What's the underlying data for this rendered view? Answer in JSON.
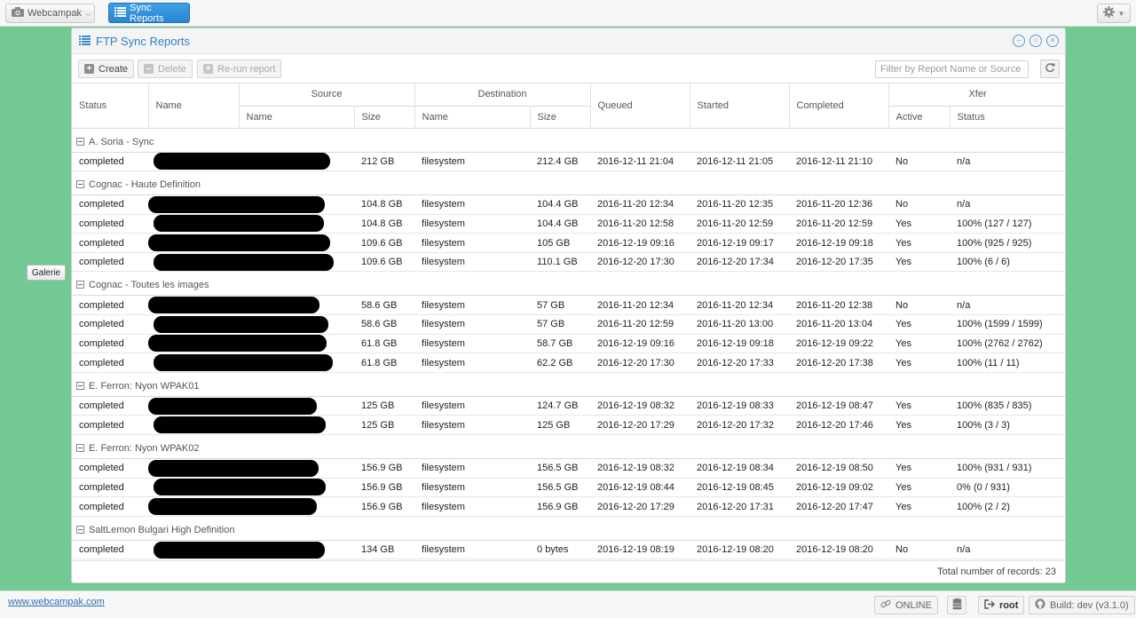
{
  "topbar": {
    "app_label": "Webcampak",
    "active_button": "Sync Reports"
  },
  "desktop": {
    "galerie_label": "Galerie"
  },
  "window": {
    "title": "FTP Sync Reports",
    "toolbar": {
      "create": "Create",
      "delete": "Delete",
      "rerun": "Re-run report"
    },
    "filter_placeholder": "Filter by Report Name or Source",
    "columns": {
      "status": "Status",
      "name": "Name",
      "source": "Source",
      "destination": "Destination",
      "queued": "Queued",
      "started": "Started",
      "completed": "Completed",
      "xfer": "Xfer",
      "sub_name": "Name",
      "sub_size": "Size",
      "sub_active": "Active",
      "sub_status": "Status"
    },
    "groups": [
      {
        "title": "A. Soria - Sync",
        "rows": [
          {
            "status": "completed",
            "src_size": "212 GB",
            "dest": "filesystem",
            "dest_size": "212.4 GB",
            "queued": "2016-12-11 21:04",
            "started": "2016-12-11 21:05",
            "completed": "2016-12-11 21:10",
            "active": "No",
            "xfer": "n/a"
          }
        ]
      },
      {
        "title": "Cognac - Haute Definition",
        "rows": [
          {
            "status": "completed",
            "src_size": "104.8 GB",
            "dest": "filesystem",
            "dest_size": "104.4 GB",
            "queued": "2016-11-20 12:34",
            "started": "2016-11-20 12:35",
            "completed": "2016-11-20 12:36",
            "active": "No",
            "xfer": "n/a"
          },
          {
            "status": "completed",
            "src_size": "104.8 GB",
            "dest": "filesystem",
            "dest_size": "104.4 GB",
            "queued": "2016-11-20 12:58",
            "started": "2016-11-20 12:59",
            "completed": "2016-11-20 12:59",
            "active": "Yes",
            "xfer": "100% (127 / 127)"
          },
          {
            "status": "completed",
            "src_size": "109.6 GB",
            "dest": "filesystem",
            "dest_size": "105 GB",
            "queued": "2016-12-19 09:16",
            "started": "2016-12-19 09:17",
            "completed": "2016-12-19 09:18",
            "active": "Yes",
            "xfer": "100% (925 / 925)"
          },
          {
            "status": "completed",
            "src_size": "109.6 GB",
            "dest": "filesystem",
            "dest_size": "110.1 GB",
            "queued": "2016-12-20 17:30",
            "started": "2016-12-20 17:34",
            "completed": "2016-12-20 17:35",
            "active": "Yes",
            "xfer": "100% (6 / 6)"
          }
        ]
      },
      {
        "title": "Cognac - Toutes les images",
        "rows": [
          {
            "status": "completed",
            "src_size": "58.6 GB",
            "dest": "filesystem",
            "dest_size": "57 GB",
            "queued": "2016-11-20 12:34",
            "started": "2016-11-20 12:34",
            "completed": "2016-11-20 12:38",
            "active": "No",
            "xfer": "n/a"
          },
          {
            "status": "completed",
            "src_size": "58.6 GB",
            "dest": "filesystem",
            "dest_size": "57 GB",
            "queued": "2016-11-20 12:59",
            "started": "2016-11-20 13:00",
            "completed": "2016-11-20 13:04",
            "active": "Yes",
            "xfer": "100% (1599 / 1599)"
          },
          {
            "status": "completed",
            "src_size": "61.8 GB",
            "dest": "filesystem",
            "dest_size": "58.7 GB",
            "queued": "2016-12-19 09:16",
            "started": "2016-12-19 09:18",
            "completed": "2016-12-19 09:22",
            "active": "Yes",
            "xfer": "100% (2762 / 2762)"
          },
          {
            "status": "completed",
            "src_size": "61.8 GB",
            "dest": "filesystem",
            "dest_size": "62.2 GB",
            "queued": "2016-12-20 17:30",
            "started": "2016-12-20 17:33",
            "completed": "2016-12-20 17:38",
            "active": "Yes",
            "xfer": "100% (11 / 11)"
          }
        ]
      },
      {
        "title": "E. Ferron: Nyon WPAK01",
        "rows": [
          {
            "status": "completed",
            "src_size": "125 GB",
            "dest": "filesystem",
            "dest_size": "124.7 GB",
            "queued": "2016-12-19 08:32",
            "started": "2016-12-19 08:33",
            "completed": "2016-12-19 08:47",
            "active": "Yes",
            "xfer": "100% (835 / 835)"
          },
          {
            "status": "completed",
            "src_size": "125 GB",
            "dest": "filesystem",
            "dest_size": "125 GB",
            "queued": "2016-12-20 17:29",
            "started": "2016-12-20 17:32",
            "completed": "2016-12-20 17:46",
            "active": "Yes",
            "xfer": "100% (3 / 3)"
          }
        ]
      },
      {
        "title": "E. Ferron: Nyon WPAK02",
        "rows": [
          {
            "status": "completed",
            "src_size": "156.9 GB",
            "dest": "filesystem",
            "dest_size": "156.5 GB",
            "queued": "2016-12-19 08:32",
            "started": "2016-12-19 08:34",
            "completed": "2016-12-19 08:50",
            "active": "Yes",
            "xfer": "100% (931 / 931)"
          },
          {
            "status": "completed",
            "src_size": "156.9 GB",
            "dest": "filesystem",
            "dest_size": "156.5 GB",
            "queued": "2016-12-19 08:44",
            "started": "2016-12-19 08:45",
            "completed": "2016-12-19 09:02",
            "active": "Yes",
            "xfer": "0% (0 / 931)"
          },
          {
            "status": "completed",
            "src_size": "156.9 GB",
            "dest": "filesystem",
            "dest_size": "156.9 GB",
            "queued": "2016-12-20 17:29",
            "started": "2016-12-20 17:31",
            "completed": "2016-12-20 17:47",
            "active": "Yes",
            "xfer": "100% (2 / 2)"
          }
        ]
      },
      {
        "title": "SaltLemon Bulgari High Definition",
        "rows": [
          {
            "status": "completed",
            "src_size": "134 GB",
            "dest": "filesystem",
            "dest_size": "0 bytes",
            "queued": "2016-12-19 08:19",
            "started": "2016-12-19 08:20",
            "completed": "2016-12-19 08:20",
            "active": "No",
            "xfer": "n/a"
          }
        ]
      }
    ],
    "footer_records": "Total number of records: 23"
  },
  "bottombar": {
    "link": "www.webcampak.com",
    "online": "ONLINE",
    "user": "root",
    "build": "Build: dev (v3.1.0)"
  }
}
